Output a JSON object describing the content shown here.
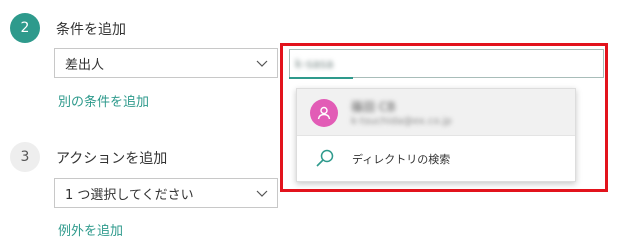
{
  "steps": {
    "condition": {
      "number": "2",
      "title": "条件を追加",
      "sender_select": {
        "value": "差出人"
      },
      "add_condition_link": "別の条件を追加"
    },
    "action": {
      "number": "3",
      "title": "アクションを追加",
      "action_select": {
        "value": "1 つ選択してください"
      },
      "add_exception_link": "例外を追加"
    }
  },
  "people_picker": {
    "input_value": "k-sasa",
    "suggestion": {
      "name": "篠田 CB",
      "email": "k-tsuchida@ex.co.jp",
      "avatar_icon": "person-icon",
      "avatar_color": "#e25cb6"
    },
    "directory_search": {
      "icon": "search-icon",
      "label": "ディレクトリの検索"
    }
  },
  "colors": {
    "accent": "#2e9a8c",
    "highlight": "#e2131c"
  }
}
